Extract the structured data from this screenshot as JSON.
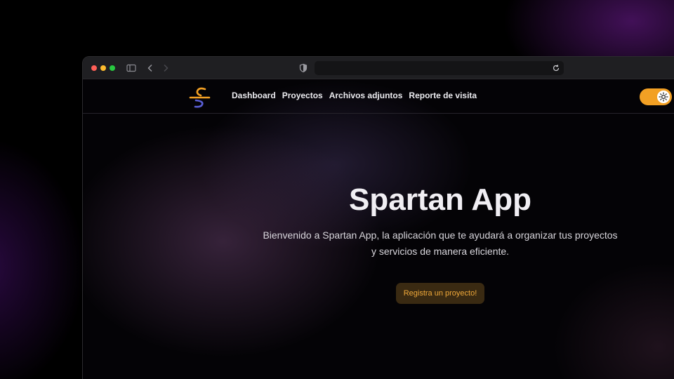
{
  "nav": {
    "links": [
      "Dashboard",
      "Proyectos",
      "Archivos adjuntos",
      "Reporte de visita"
    ]
  },
  "hero": {
    "title": "Spartan App",
    "description": "Bienvenido a Spartan App, la aplicación que te ayudará a organizar tus proyectos y servicios de manera eficiente.",
    "cta_label": "Registra un proyecto!"
  },
  "browser": {
    "url": ""
  },
  "icons": {
    "titlebar": [
      "sidebar-icon",
      "back-icon",
      "forward-icon",
      "shield-icon",
      "reload-icon"
    ],
    "theme_toggle": "sun-icon"
  },
  "colors": {
    "accent": "#f2a024",
    "cta_bg": "#3a2a12",
    "cta_text": "#f0a93a",
    "background": "#040306"
  }
}
